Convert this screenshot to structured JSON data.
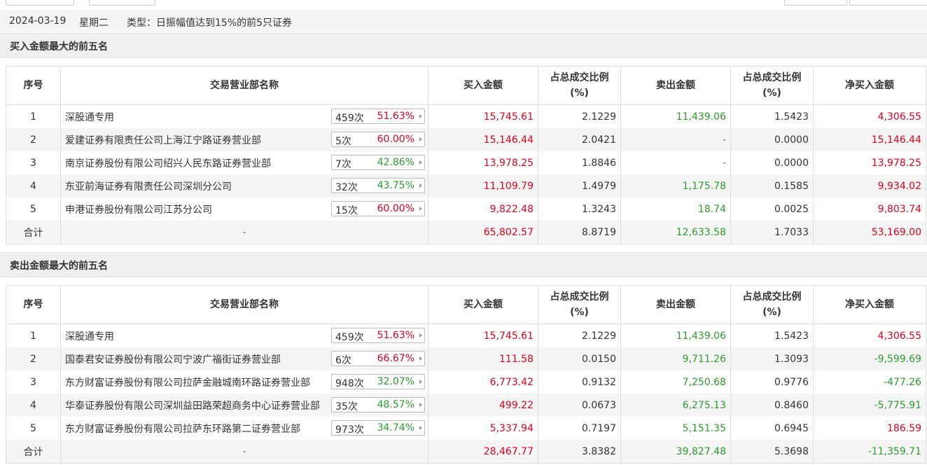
{
  "info": {
    "date": "2024-03-19",
    "weekday": "星期二",
    "type_text": "类型：日振幅值达到15%的前5只证券"
  },
  "headers": {
    "index": "序号",
    "name": "交易营业部名称",
    "buy": "买入金额",
    "buy_ratio_1": "占总成交比例",
    "buy_ratio_2": "(%)",
    "sell": "卖出金额",
    "sell_ratio_1": "占总成交比例",
    "sell_ratio_2": "(%)",
    "net": "净买入金额"
  },
  "buy_section": {
    "title": "买入金额最大的前五名",
    "rows": [
      {
        "idx": "1",
        "name": "深股通专用",
        "count": "459次",
        "pct": "51.63%",
        "pct_color": "red",
        "buy": "15,745.61",
        "buy_ratio": "2.1229",
        "sell": "11,439.06",
        "sell_ratio": "1.5423",
        "net": "4,306.55",
        "net_color": "red"
      },
      {
        "idx": "2",
        "name": "爱建证券有限责任公司上海江宁路证券营业部",
        "count": "5次",
        "pct": "60.00%",
        "pct_color": "red",
        "buy": "15,146.44",
        "buy_ratio": "2.0421",
        "sell": "-",
        "sell_ratio": "0.0000",
        "net": "15,146.44",
        "net_color": "red"
      },
      {
        "idx": "3",
        "name": "南京证券股份有限公司绍兴人民东路证券营业部",
        "count": "7次",
        "pct": "42.86%",
        "pct_color": "green",
        "buy": "13,978.25",
        "buy_ratio": "1.8846",
        "sell": "-",
        "sell_ratio": "0.0000",
        "net": "13,978.25",
        "net_color": "red"
      },
      {
        "idx": "4",
        "name": "东亚前海证券有限责任公司深圳分公司",
        "count": "32次",
        "pct": "43.75%",
        "pct_color": "green",
        "buy": "11,109.79",
        "buy_ratio": "1.4979",
        "sell": "1,175.78",
        "sell_ratio": "0.1585",
        "net": "9,934.02",
        "net_color": "red"
      },
      {
        "idx": "5",
        "name": "申港证券股份有限公司江苏分公司",
        "count": "15次",
        "pct": "60.00%",
        "pct_color": "red",
        "buy": "9,822.48",
        "buy_ratio": "1.3243",
        "sell": "18.74",
        "sell_ratio": "0.0025",
        "net": "9,803.74",
        "net_color": "red"
      }
    ],
    "total": {
      "label": "合计",
      "name": "-",
      "buy": "65,802.57",
      "buy_ratio": "8.8719",
      "sell": "12,633.58",
      "sell_ratio": "1.7033",
      "net": "53,169.00",
      "net_color": "red"
    }
  },
  "sell_section": {
    "title": "卖出金额最大的前五名",
    "rows": [
      {
        "idx": "1",
        "name": "深股通专用",
        "count": "459次",
        "pct": "51.63%",
        "pct_color": "red",
        "buy": "15,745.61",
        "buy_ratio": "2.1229",
        "sell": "11,439.06",
        "sell_ratio": "1.5423",
        "net": "4,306.55",
        "net_color": "red"
      },
      {
        "idx": "2",
        "name": "国泰君安证券股份有限公司宁波广福街证券营业部",
        "count": "6次",
        "pct": "66.67%",
        "pct_color": "red",
        "buy": "111.58",
        "buy_ratio": "0.0150",
        "sell": "9,711.26",
        "sell_ratio": "1.3093",
        "net": "-9,599.69",
        "net_color": "green"
      },
      {
        "idx": "3",
        "name": "东方财富证券股份有限公司拉萨金融城南环路证券营业部",
        "count": "948次",
        "pct": "32.07%",
        "pct_color": "green",
        "buy": "6,773.42",
        "buy_ratio": "0.9132",
        "sell": "7,250.68",
        "sell_ratio": "0.9776",
        "net": "-477.26",
        "net_color": "green"
      },
      {
        "idx": "4",
        "name": "华泰证券股份有限公司深圳益田路荣超商务中心证券营业部",
        "count": "35次",
        "pct": "48.57%",
        "pct_color": "green",
        "buy": "499.22",
        "buy_ratio": "0.0673",
        "sell": "6,275.13",
        "sell_ratio": "0.8460",
        "net": "-5,775.91",
        "net_color": "green"
      },
      {
        "idx": "5",
        "name": "东方财富证券股份有限公司拉萨东环路第二证券营业部",
        "count": "973次",
        "pct": "34.74%",
        "pct_color": "green",
        "buy": "5,337.94",
        "buy_ratio": "0.7197",
        "sell": "5,151.35",
        "sell_ratio": "0.6945",
        "net": "186.59",
        "net_color": "red"
      }
    ],
    "total": {
      "label": "合计",
      "name": "-",
      "buy": "28,467.77",
      "buy_ratio": "3.8382",
      "sell": "39,827.48",
      "sell_ratio": "5.3698",
      "net": "-11,359.71",
      "net_color": "green"
    }
  }
}
